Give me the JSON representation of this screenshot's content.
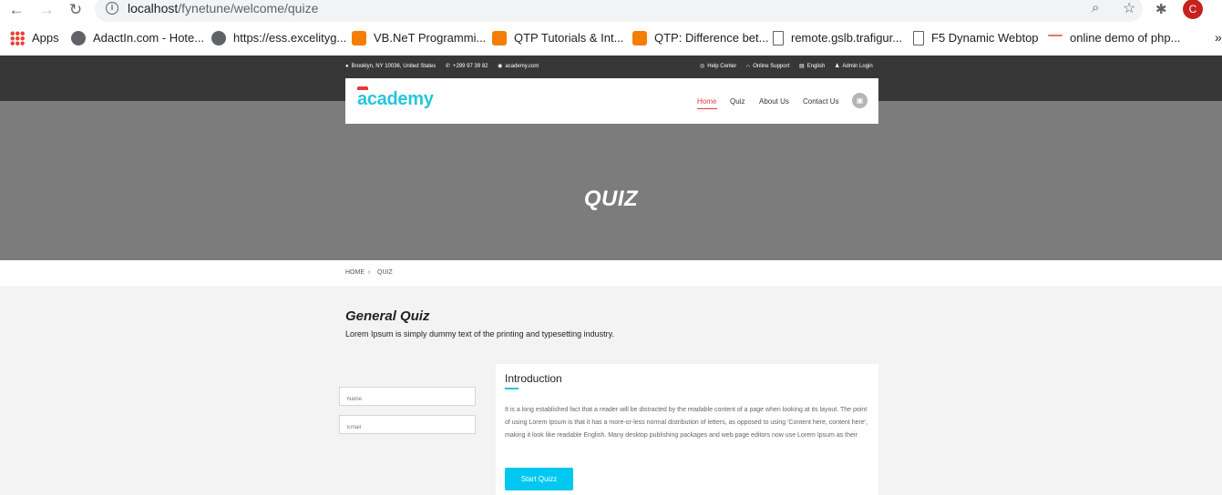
{
  "browser": {
    "url_host": "localhost",
    "url_path": "/fynetune/welcome/quize",
    "profile_initial": "C",
    "icons": {
      "back": "arrow-left-icon",
      "forward": "arrow-right-icon",
      "reload": "reload-icon",
      "info": "info-icon",
      "zoom": "zoom-icon",
      "star": "star-icon",
      "extensions": "puzzle-icon"
    }
  },
  "bookmarks": [
    {
      "label": "Apps",
      "icon": "apps-grid-icon"
    },
    {
      "label": "AdactIn.com - Hote...",
      "icon": "globe-icon"
    },
    {
      "label": "https://ess.excelityg...",
      "icon": "globe-icon"
    },
    {
      "label": "VB.NeT Programmi...",
      "icon": "blogger-icon"
    },
    {
      "label": "QTP Tutorials & Int...",
      "icon": "blogger-icon"
    },
    {
      "label": "QTP: Difference bet...",
      "icon": "blogger-icon"
    },
    {
      "label": "remote.gslb.trafigur...",
      "icon": "document-icon"
    },
    {
      "label": "F5 Dynamic Webtop",
      "icon": "document-icon"
    },
    {
      "label": "online demo of php...",
      "icon": "dash-icon"
    }
  ],
  "topbar": {
    "address": "Brooklyn, NY 10036, United States",
    "phone": "+299 97 39 82",
    "website": "academy.com",
    "help": "Help Center",
    "support": "Online Support",
    "language": "English",
    "admin": "Admin Login"
  },
  "header": {
    "logo": "academy",
    "nav": [
      "Home",
      "Quiz",
      "About Us",
      "Contact Us"
    ],
    "active_nav": "Home"
  },
  "banner": {
    "title": "QUIZ"
  },
  "breadcrumb": {
    "home": "HOME",
    "separator": "›",
    "current": "QUIZ"
  },
  "content": {
    "title": "General Quiz",
    "subtitle": "Lorem Ipsum is simply dummy text of the printing and typesetting industry.",
    "form": {
      "name_placeholder": "Name",
      "email_placeholder": "Email"
    },
    "card": {
      "title": "Introduction",
      "text": "It is a long established fact that a reader will be distracted by the readable content of a page when looking at its layout. The point of using Lorem Ipsum is that it has a more-or-less normal distribution of letters, as opposed to using 'Content here, content here', making it look like readable English. Many desktop publishing packages and web page editors now use Lorem Ipsum as their",
      "button": "Start Quizz"
    }
  },
  "colors": {
    "accent_red": "#e53935",
    "accent_cyan": "#26c6da",
    "button_cyan": "#00c8f0",
    "topbar_bg": "#373737",
    "banner_bg": "#7c7c7c"
  }
}
